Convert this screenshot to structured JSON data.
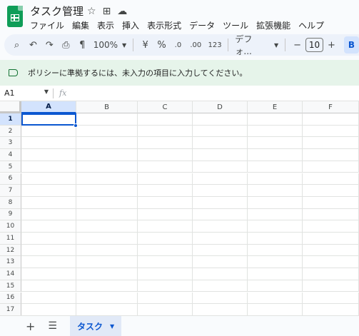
{
  "header": {
    "title": "タスク管理",
    "icons": [
      "star-icon",
      "move-to-folder-icon",
      "cloud-status-icon"
    ]
  },
  "menu": [
    "ファイル",
    "編集",
    "表示",
    "挿入",
    "表示形式",
    "データ",
    "ツール",
    "拡張機能",
    "ヘルプ"
  ],
  "toolbar": {
    "zoom": "100%",
    "currency": "¥",
    "percent": "%",
    "decrease_decimal": ".0",
    "increase_decimal": ".00",
    "number_format": "123",
    "font": "デフォ...",
    "font_size": "10",
    "minus": "−",
    "plus": "+",
    "bold": "B"
  },
  "banner": {
    "text": "ポリシーに準拠するには、未入力の項目に入力してください。"
  },
  "formula_bar": {
    "cell_ref": "A1",
    "fx": "fx",
    "value": ""
  },
  "grid": {
    "columns": [
      "A",
      "B",
      "C",
      "D",
      "E",
      "F"
    ],
    "rows": [
      "1",
      "2",
      "3",
      "4",
      "5",
      "6",
      "7",
      "8",
      "9",
      "10",
      "11",
      "12",
      "13",
      "14",
      "15",
      "16",
      "17"
    ],
    "selected_cell": "A1"
  },
  "sheets": {
    "tabs": [
      "タスク"
    ]
  },
  "colors": {
    "brand": "#0f9d58",
    "accent": "#0b57d0",
    "banner_bg": "#e6f4ea"
  }
}
